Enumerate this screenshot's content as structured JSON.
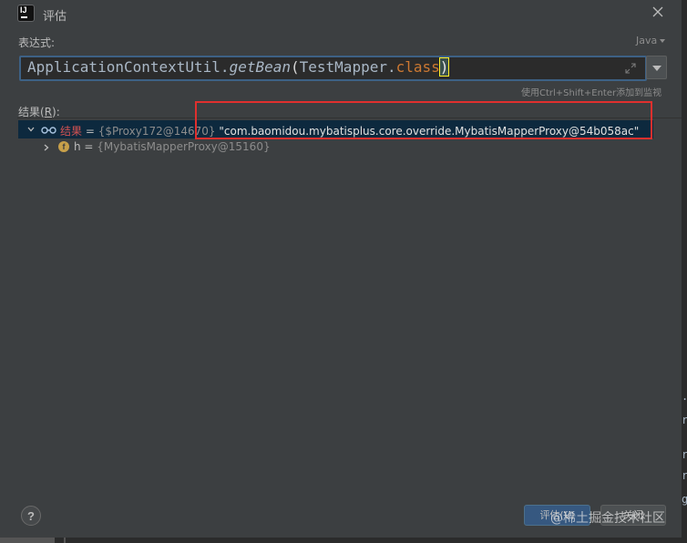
{
  "window": {
    "title": "评估"
  },
  "expression": {
    "label": "表达式:",
    "language": "Java",
    "tokens": {
      "t1": "ApplicationContextUtil.",
      "t2": "getBean",
      "t3": "(",
      "t4": "TestMapper.",
      "t5": "class",
      "t6": ")"
    },
    "hint": "使用Ctrl+Shift+Enter添加到监视"
  },
  "result": {
    "label_prefix": "结果(",
    "label_mnemonic": "R",
    "label_suffix": "):",
    "rows": [
      {
        "name": "结果",
        "eq": " = ",
        "ref": "{$Proxy172@14670}",
        "value": " \"com.baomidou.mybatisplus.core.override.MybatisMapperProxy@54b058ac\"",
        "expanded": true
      },
      {
        "badge": "f",
        "name": "h",
        "eq": " = ",
        "ref": "{MybatisMapperProxy@15160}",
        "expanded": false
      }
    ]
  },
  "footer": {
    "help": "?",
    "evaluate": "评估(V)",
    "close": "关闭",
    "watermark": "@稀土掘金技术社区"
  },
  "colors": {
    "highlight_box": "#e0302e",
    "selected_row": "#0d293e",
    "keyword": "#cc7832"
  }
}
